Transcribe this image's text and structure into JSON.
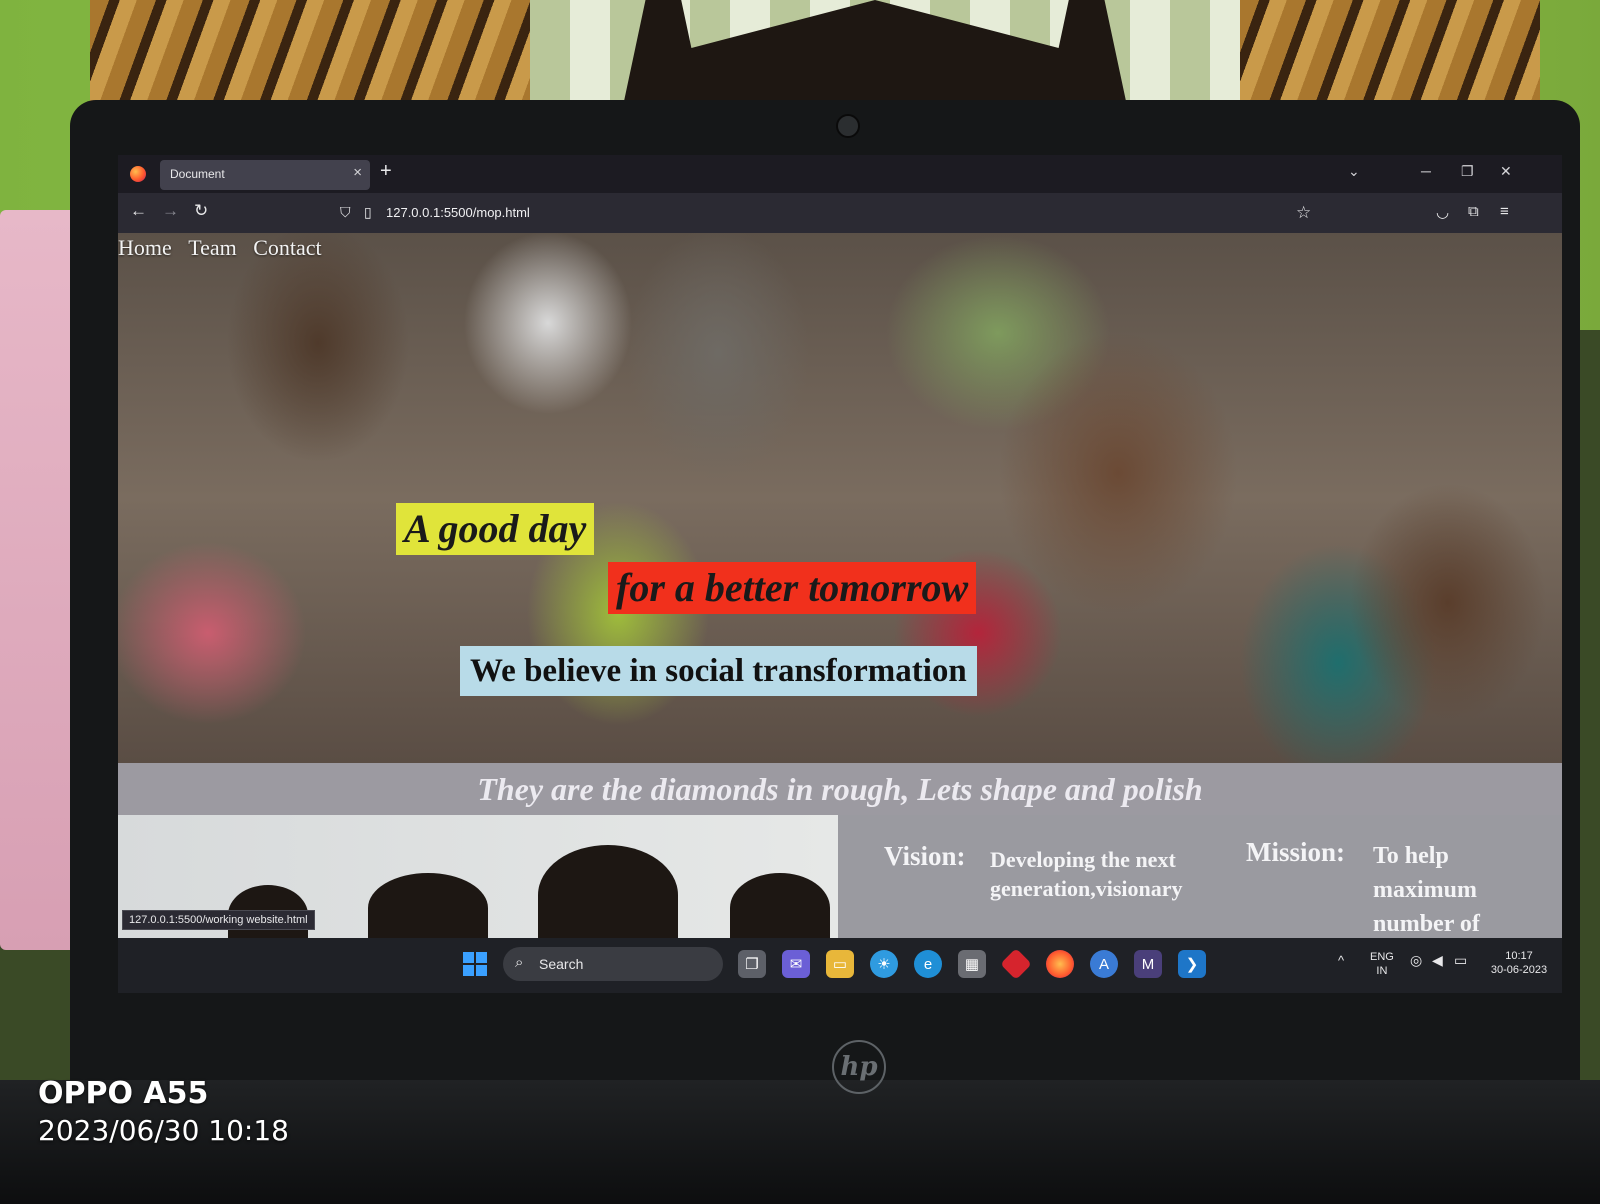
{
  "browser": {
    "tab_title": "Document",
    "tab_close": "×",
    "new_tab": "+",
    "tab_list": "⌄",
    "url": "127.0.0.1:5500/mop.html",
    "status_url": "127.0.0.1:5500/working website.html"
  },
  "site": {
    "nav": [
      "Home",
      "Team",
      "Contact"
    ],
    "headline_1": "A good day",
    "headline_2": "for a better tomorrow",
    "headline_3": "We believe in social transformation",
    "tagline": "They are the diamonds in rough, Lets shape and polish",
    "vision_label": "Vision:",
    "vision_text": "Developing the next generation,visionary",
    "mission_label": "Mission:",
    "mission_text": "To help maximum number of"
  },
  "taskbar": {
    "search_label": "Search",
    "lang_line1": "ENG",
    "lang_line2": "IN",
    "time": "10:17",
    "date": "30-06-2023"
  },
  "camera_overlay": {
    "device": "OPPO A55",
    "timestamp": "2023/06/30 10:18"
  },
  "hardware": {
    "laptop_logo": "hp"
  },
  "colors": {
    "highlight_yellow": "#e0e43a",
    "highlight_red": "#f1301c",
    "highlight_blue": "#b8dbe8",
    "tagline_band": "#9c9aa1",
    "browser_chrome": "#2b2a33"
  }
}
